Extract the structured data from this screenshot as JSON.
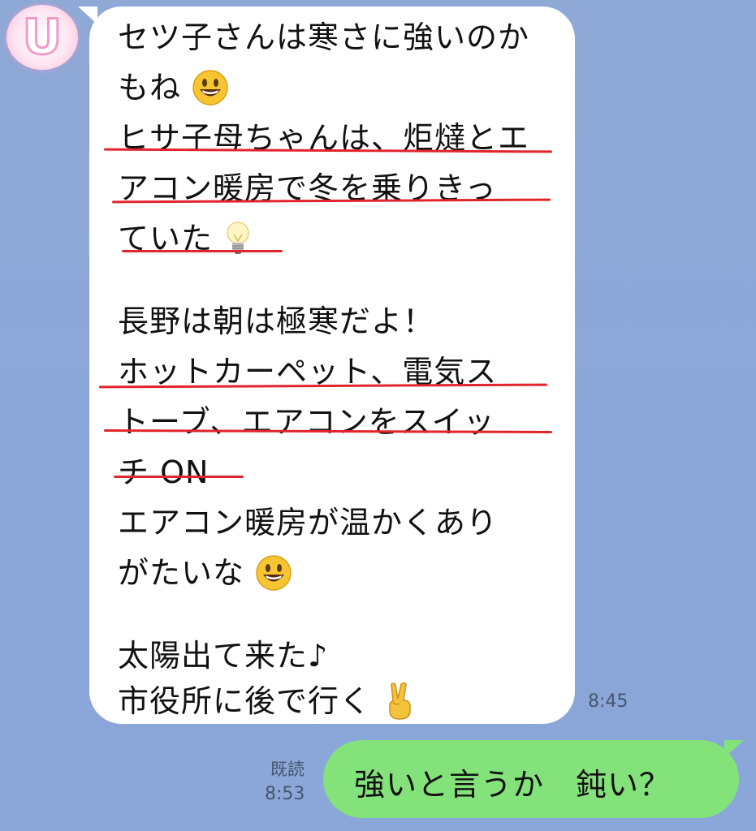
{
  "avatar": {
    "letter": "U"
  },
  "incoming": {
    "lines": [
      "セツ子さんは寒さに強いのか",
      "もね",
      "ヒサ子母ちゃんは、炬燵とエ",
      "アコン暖房で冬を乗りきっ",
      "ていた",
      "長野は朝は極寒だよ！",
      "ホットカーペット、電気ス",
      "トーブ、エアコンをスイッ",
      "チ ON",
      "エアコン暖房が温かくあり",
      "がたいな",
      "太陽出て来た♪",
      "市役所に後で行く"
    ],
    "time": "8:45"
  },
  "emoji": [
    "smiley-icon",
    "lightbulb-icon",
    "smiley-icon",
    "victory-hand-icon"
  ],
  "outgoing": {
    "text": "強いと言うか　鈍い？",
    "read_label": "既読",
    "time": "8:53"
  },
  "colors": {
    "background": "#8ba7d9",
    "incoming_bubble": "#ffffff",
    "outgoing_bubble": "#84e27a",
    "underline": "#e2242c"
  }
}
